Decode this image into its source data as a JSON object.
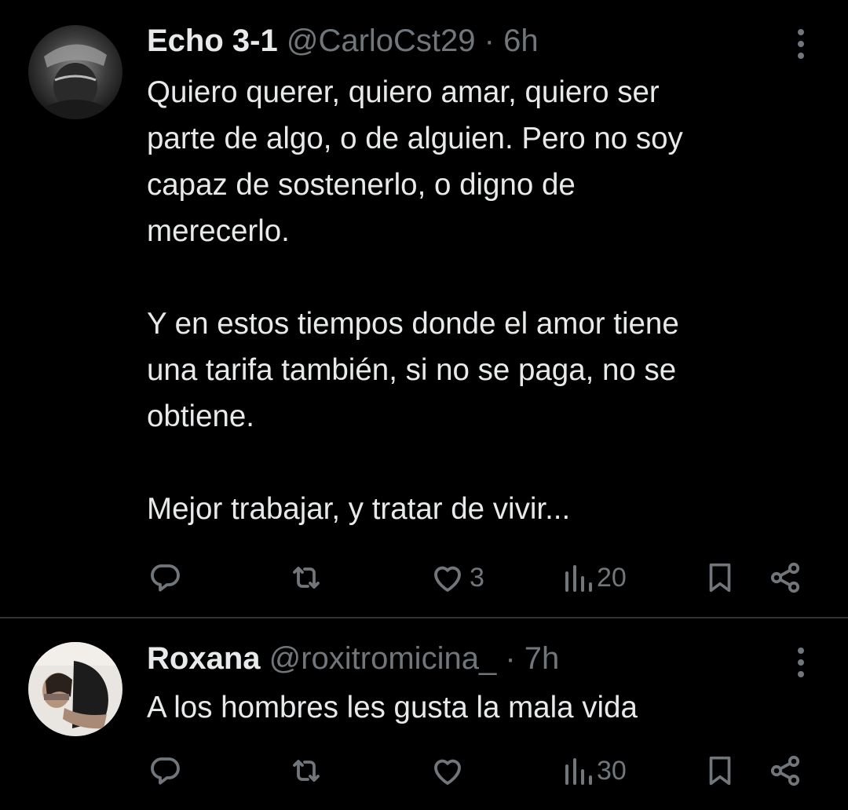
{
  "tweets": [
    {
      "name": "Echo 3-1",
      "handle": "@CarloCst29",
      "separator": "·",
      "time": "6h",
      "lines": [
        "Quiero querer, quiero amar, quiero ser",
        "parte de algo, o de alguien. Pero no soy",
        "capaz de sostenerlo, o digno de",
        "merecerlo.",
        "",
        "Y en estos tiempos donde el amor tiene",
        "una tarifa también, si no se paga, no se",
        "obtiene.",
        "",
        "Mejor trabajar, y tratar de vivir..."
      ],
      "replies": "",
      "reposts": "",
      "likes": "3",
      "views": "20"
    },
    {
      "name": "Roxana",
      "handle": "@roxitromicina_",
      "separator": "·",
      "time": "7h",
      "lines": [
        "A los hombres les gusta la mala vida"
      ],
      "replies": "",
      "reposts": "",
      "likes": "",
      "views": "30"
    }
  ],
  "colors": {
    "background": "#000000",
    "text": "#e7e9ea",
    "muted": "#71767b",
    "divider": "#2f3336"
  },
  "icons": [
    "reply-icon",
    "repost-icon",
    "like-icon",
    "views-icon",
    "bookmark-icon",
    "share-icon",
    "more-icon"
  ]
}
